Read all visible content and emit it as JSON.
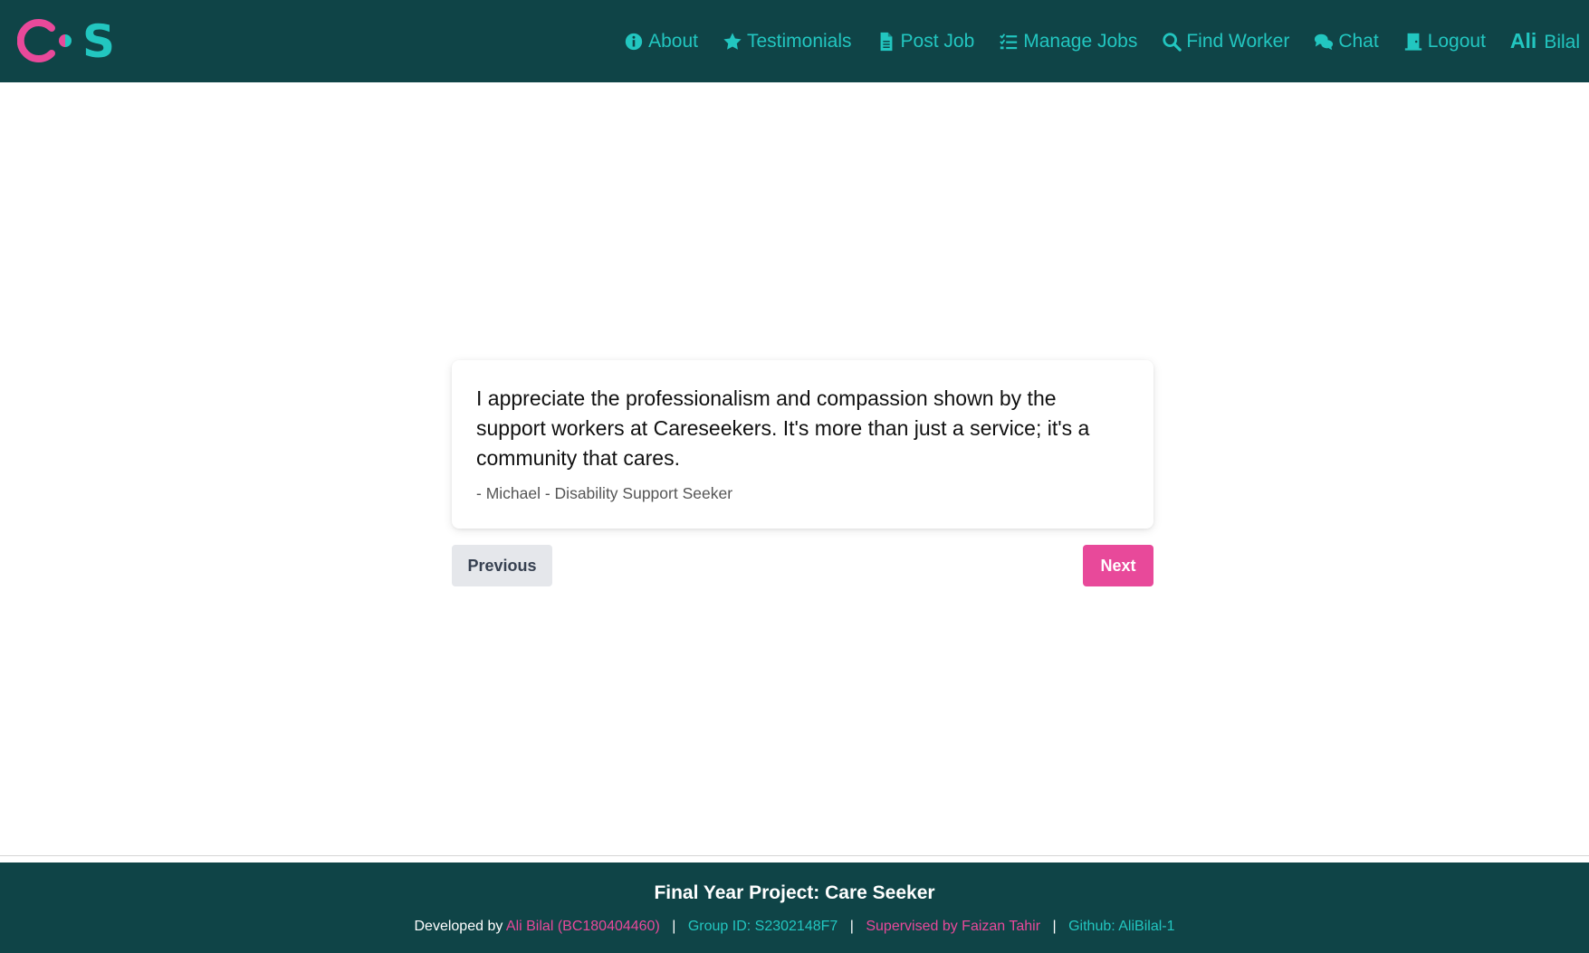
{
  "brand": {
    "logo_left": "C",
    "logo_right": "S",
    "colors": {
      "pink": "#e8499a",
      "teal": "#22c6c0",
      "header_bg": "#0f4447"
    }
  },
  "nav": {
    "items": [
      {
        "label": "About",
        "icon": "info-circle-icon"
      },
      {
        "label": "Testimonials",
        "icon": "star-icon"
      },
      {
        "label": "Post Job",
        "icon": "document-icon"
      },
      {
        "label": "Manage Jobs",
        "icon": "checklist-icon"
      },
      {
        "label": "Find Worker",
        "icon": "search-icon"
      },
      {
        "label": "Chat",
        "icon": "chat-bubbles-icon"
      },
      {
        "label": "Logout",
        "icon": "door-icon"
      }
    ],
    "user": {
      "first": "Ali",
      "last": "Bilal"
    }
  },
  "testimonial": {
    "quote": "I appreciate the professionalism and compassion shown by the support workers at Careseekers. It's more than just a service; it's a community that cares.",
    "author": "- Michael - Disability Support Seeker"
  },
  "buttons": {
    "previous": "Previous",
    "next": "Next"
  },
  "footer": {
    "title": "Final Year Project: Care Seeker",
    "developed_by_prefix": "Developed by",
    "developer": "Ali Bilal (BC180404460)",
    "group_id": "Group ID: S2302148F7",
    "supervisor": "Supervised by Faizan Tahir",
    "github": "Github: AliBilal-1",
    "separator": "|"
  }
}
